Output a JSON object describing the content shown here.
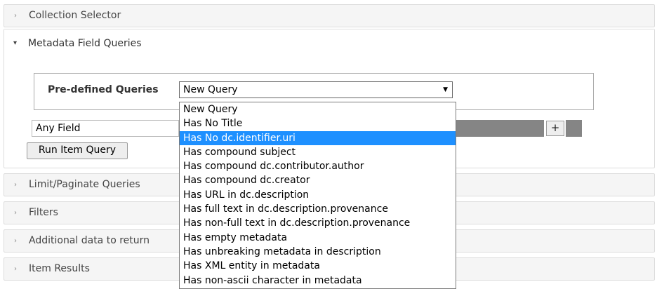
{
  "sections": {
    "collection_selector": "Collection Selector",
    "metadata_field_queries": "Metadata Field Queries",
    "limit_paginate": "Limit/Paginate Queries",
    "filters": "Filters",
    "additional_data": "Additional data to return",
    "item_results": "Item Results"
  },
  "icons": {
    "collapsed_caret": "›",
    "expanded_caret": "▾"
  },
  "query_panel": {
    "predefined_label": "Pre-defined Queries",
    "selected_query": "New Query",
    "field_select_value": "Any Field",
    "add_label": "+",
    "run_label": "Run Item Query"
  },
  "dropdown": {
    "highlighted_index": 2,
    "options": [
      "New Query",
      "Has No Title",
      "Has No dc.identifier.uri",
      "Has compound subject",
      "Has compound dc.contributor.author",
      "Has compound dc.creator",
      "Has URL in dc.description",
      "Has full text in dc.description.provenance",
      "Has non-full text in dc.description.provenance",
      "Has empty metadata",
      "Has unbreaking metadata in description",
      "Has XML entity in metadata",
      "Has non-ascii character in metadata"
    ]
  },
  "colors": {
    "highlight": "#1e90ff",
    "header_bg": "#f5f5f5",
    "border": "#dddddd"
  }
}
